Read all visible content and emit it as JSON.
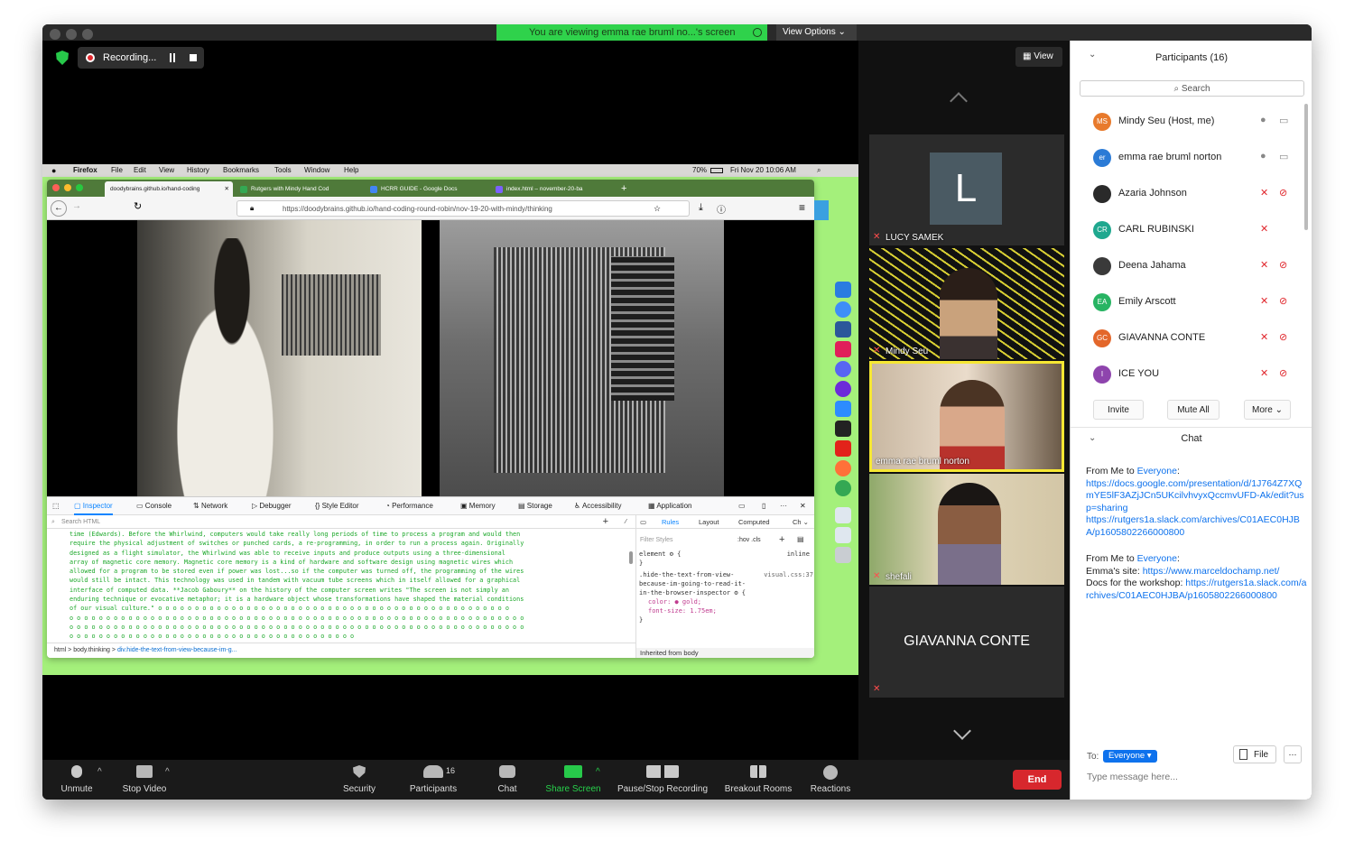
{
  "window": {
    "share_banner": "You are viewing emma rae bruml no...'s screen",
    "view_options": "View Options ⌄",
    "recording_label": "Recording...",
    "view_button": "View"
  },
  "mac_menu": [
    "Firefox",
    "File",
    "Edit",
    "View",
    "History",
    "Bookmarks",
    "Tools",
    "Window",
    "Help"
  ],
  "mac_status": {
    "battery": "70%",
    "clock": "Fri Nov 20  10:06 AM"
  },
  "browser": {
    "tabs": [
      {
        "label": "doodybrains.github.io/hand-coding",
        "color": "#f5f5f5"
      },
      {
        "label": "Rutgers with Mindy Hand Cod",
        "color": "#34a853"
      },
      {
        "label": "HCRR GUIDE - Google Docs",
        "color": "#4285f4"
      },
      {
        "label": "index.html – november-20-ba",
        "color": "#7b61ff"
      }
    ],
    "url": "https://doodybrains.github.io/hand-coding-round-robin/nov-19-20-with-mindy/thinking"
  },
  "devtools": {
    "tabs": [
      "Inspector",
      "Console",
      "Network",
      "Debugger",
      "Style Editor",
      "Performance",
      "Memory",
      "Storage",
      "Accessibility",
      "Application"
    ],
    "search_placeholder": "Search HTML",
    "code_lines": [
      "time (Edwards). Before the Whirlwind, computers would take really long periods of time to process a program and would then",
      "require the physical adjustment of switches or punched cards, a re-programming, in order to run a process again. Originally",
      "designed as a flight simulator, the Whirlwind was able to receive inputs and produce outputs using a three-dimensional",
      "array of magnetic core memory. Magnetic core memory is a kind of hardware and software design using magnetic wires which",
      "allowed for a program to be stored even if power was lost...so if the computer was turned off, the programming of the wires",
      "would still be intact. This technology was used in tandem with vacuum tube screens which in itself allowed for a graphical",
      "interface of computed data. **Jacob Gaboury** on the history of the computer screen writes \"The screen is not simply an",
      "enduring technique or evocative metaphor; it is a hardware object whose transformations have shaped the material conditions",
      "of our visual culture.\" o o o o o o o o o o o o o o o o o o o o o o o o o o o o o o o o o o o o o o o o o o o o o o o o",
      "o o o o o o o o o o o o o o o o o o o o o o o o o o o o o o o o o o o o o o o o o o o o o o o o o o o o o o o o o o o o o o",
      "o o o o o o o o o o o o o o o o o o o o o o o o o o o o o o o o o o o o o o o o o o o o o o o o o o o o o o o o o o o o o o",
      "o o o o o o o o o o o o o o o o o o o o o o o o o o o o o o o o o o o o o o o"
    ],
    "breadcrumbs": [
      "html",
      "body.thinking",
      "div.hide-the-text-from-view-because-im-g..."
    ],
    "rules_tabs": [
      "Rules",
      "Layout",
      "Computed",
      "Ch ⌄"
    ],
    "filter_placeholder": "Filter Styles",
    "hov_cls": ":hov .cls",
    "rule_element": "element ⚙ {",
    "rule_inline": "inline",
    "rule_close": "}",
    "rule_selector": ".hide-the-text-from-view-because-im-going-to-read-it-in-the-browser-inspector ⚙ {",
    "rule_source": "visual.css:37",
    "rule_prop1": "color: ● gold;",
    "rule_prop2": "font-size: 1.75em;",
    "inherited": "Inherited from body"
  },
  "gallery": {
    "tiles": [
      {
        "name": "LUCY SAMEK",
        "initial": "L"
      },
      {
        "name": "Mindy Seu"
      },
      {
        "name": "emma rae bruml norton"
      },
      {
        "name": "shefali"
      },
      {
        "name": "GIAVANNA CONTE"
      }
    ]
  },
  "toolbar": {
    "unmute": "Unmute",
    "stop_video": "Stop Video",
    "security": "Security",
    "participants": "Participants",
    "participants_count": "16",
    "chat": "Chat",
    "share_screen": "Share Screen",
    "pause_stop": "Pause/Stop Recording",
    "breakout": "Breakout Rooms",
    "reactions": "Reactions",
    "end": "End"
  },
  "participants_panel": {
    "title": "Participants (16)",
    "search": "Search",
    "people": [
      {
        "initials": "MS",
        "name": "Mindy Seu (Host, me)",
        "color": "#e87a2c"
      },
      {
        "initials": "er",
        "name": "emma rae bruml norton",
        "color": "#2b7bd6"
      },
      {
        "initials": "",
        "name": "Azaria Johnson",
        "color": "#2a2a2a"
      },
      {
        "initials": "CR",
        "name": "CARL RUBINSKI",
        "color": "#1fa88f"
      },
      {
        "initials": "",
        "name": "Deena Jahama",
        "color": "#3a3a3a"
      },
      {
        "initials": "EA",
        "name": "Emily Arscott",
        "color": "#28b463"
      },
      {
        "initials": "GC",
        "name": "GIAVANNA CONTE",
        "color": "#e3672b"
      },
      {
        "initials": "I",
        "name": "ICE YOU",
        "color": "#8e44ad"
      }
    ],
    "invite": "Invite",
    "mute_all": "Mute All",
    "more": "More ⌄"
  },
  "chat": {
    "title": "Chat",
    "messages": [
      {
        "from": "From Me to ",
        "to": "Everyone",
        "text": "",
        "links": [
          "https://docs.google.com/presentation/d/1J764Z7XQmYE5lF3AZjJCn5UKcilvhvyxQccmvUFD-Ak/edit?usp=sharing",
          "https://rutgers1a.slack.com/archives/C01AEC0HJBA/p1605802266000800"
        ]
      },
      {
        "from": "From Me to ",
        "to": "Everyone",
        "site_label": "Emma's site: ",
        "site": "https://www.marceldochamp.net/",
        "docs_label": "Docs for the workshop: ",
        "docs": "https://rutgers1a.slack.com/archives/C01AEC0HJBA/p1605802266000800"
      }
    ],
    "to_label": "To:",
    "to_value": "Everyone ▾",
    "file": "File",
    "more": "···",
    "placeholder": "Type message here..."
  }
}
